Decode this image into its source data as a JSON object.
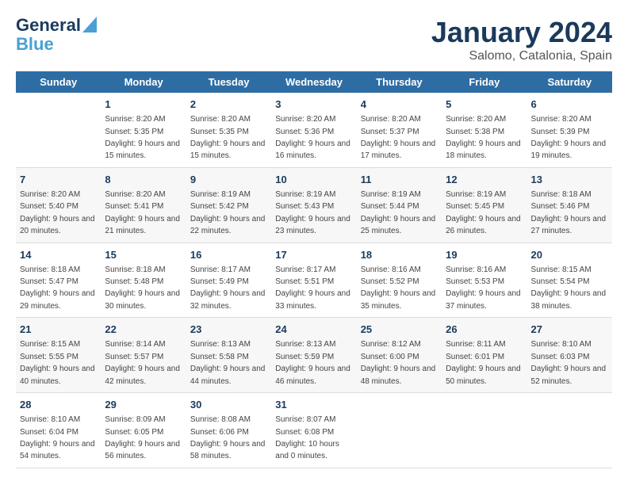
{
  "logo": {
    "line1": "General",
    "line2": "Blue"
  },
  "title": "January 2024",
  "location": "Salomo, Catalonia, Spain",
  "weekdays": [
    "Sunday",
    "Monday",
    "Tuesday",
    "Wednesday",
    "Thursday",
    "Friday",
    "Saturday"
  ],
  "weeks": [
    [
      {
        "day": null,
        "sunrise": null,
        "sunset": null,
        "daylight": null
      },
      {
        "day": "1",
        "sunrise": "8:20 AM",
        "sunset": "5:35 PM",
        "daylight": "9 hours and 15 minutes."
      },
      {
        "day": "2",
        "sunrise": "8:20 AM",
        "sunset": "5:35 PM",
        "daylight": "9 hours and 15 minutes."
      },
      {
        "day": "3",
        "sunrise": "8:20 AM",
        "sunset": "5:36 PM",
        "daylight": "9 hours and 16 minutes."
      },
      {
        "day": "4",
        "sunrise": "8:20 AM",
        "sunset": "5:37 PM",
        "daylight": "9 hours and 17 minutes."
      },
      {
        "day": "5",
        "sunrise": "8:20 AM",
        "sunset": "5:38 PM",
        "daylight": "9 hours and 18 minutes."
      },
      {
        "day": "6",
        "sunrise": "8:20 AM",
        "sunset": "5:39 PM",
        "daylight": "9 hours and 19 minutes."
      }
    ],
    [
      {
        "day": "7",
        "sunrise": "8:20 AM",
        "sunset": "5:40 PM",
        "daylight": "9 hours and 20 minutes."
      },
      {
        "day": "8",
        "sunrise": "8:20 AM",
        "sunset": "5:41 PM",
        "daylight": "9 hours and 21 minutes."
      },
      {
        "day": "9",
        "sunrise": "8:19 AM",
        "sunset": "5:42 PM",
        "daylight": "9 hours and 22 minutes."
      },
      {
        "day": "10",
        "sunrise": "8:19 AM",
        "sunset": "5:43 PM",
        "daylight": "9 hours and 23 minutes."
      },
      {
        "day": "11",
        "sunrise": "8:19 AM",
        "sunset": "5:44 PM",
        "daylight": "9 hours and 25 minutes."
      },
      {
        "day": "12",
        "sunrise": "8:19 AM",
        "sunset": "5:45 PM",
        "daylight": "9 hours and 26 minutes."
      },
      {
        "day": "13",
        "sunrise": "8:18 AM",
        "sunset": "5:46 PM",
        "daylight": "9 hours and 27 minutes."
      }
    ],
    [
      {
        "day": "14",
        "sunrise": "8:18 AM",
        "sunset": "5:47 PM",
        "daylight": "9 hours and 29 minutes."
      },
      {
        "day": "15",
        "sunrise": "8:18 AM",
        "sunset": "5:48 PM",
        "daylight": "9 hours and 30 minutes."
      },
      {
        "day": "16",
        "sunrise": "8:17 AM",
        "sunset": "5:49 PM",
        "daylight": "9 hours and 32 minutes."
      },
      {
        "day": "17",
        "sunrise": "8:17 AM",
        "sunset": "5:51 PM",
        "daylight": "9 hours and 33 minutes."
      },
      {
        "day": "18",
        "sunrise": "8:16 AM",
        "sunset": "5:52 PM",
        "daylight": "9 hours and 35 minutes."
      },
      {
        "day": "19",
        "sunrise": "8:16 AM",
        "sunset": "5:53 PM",
        "daylight": "9 hours and 37 minutes."
      },
      {
        "day": "20",
        "sunrise": "8:15 AM",
        "sunset": "5:54 PM",
        "daylight": "9 hours and 38 minutes."
      }
    ],
    [
      {
        "day": "21",
        "sunrise": "8:15 AM",
        "sunset": "5:55 PM",
        "daylight": "9 hours and 40 minutes."
      },
      {
        "day": "22",
        "sunrise": "8:14 AM",
        "sunset": "5:57 PM",
        "daylight": "9 hours and 42 minutes."
      },
      {
        "day": "23",
        "sunrise": "8:13 AM",
        "sunset": "5:58 PM",
        "daylight": "9 hours and 44 minutes."
      },
      {
        "day": "24",
        "sunrise": "8:13 AM",
        "sunset": "5:59 PM",
        "daylight": "9 hours and 46 minutes."
      },
      {
        "day": "25",
        "sunrise": "8:12 AM",
        "sunset": "6:00 PM",
        "daylight": "9 hours and 48 minutes."
      },
      {
        "day": "26",
        "sunrise": "8:11 AM",
        "sunset": "6:01 PM",
        "daylight": "9 hours and 50 minutes."
      },
      {
        "day": "27",
        "sunrise": "8:10 AM",
        "sunset": "6:03 PM",
        "daylight": "9 hours and 52 minutes."
      }
    ],
    [
      {
        "day": "28",
        "sunrise": "8:10 AM",
        "sunset": "6:04 PM",
        "daylight": "9 hours and 54 minutes."
      },
      {
        "day": "29",
        "sunrise": "8:09 AM",
        "sunset": "6:05 PM",
        "daylight": "9 hours and 56 minutes."
      },
      {
        "day": "30",
        "sunrise": "8:08 AM",
        "sunset": "6:06 PM",
        "daylight": "9 hours and 58 minutes."
      },
      {
        "day": "31",
        "sunrise": "8:07 AM",
        "sunset": "6:08 PM",
        "daylight": "10 hours and 0 minutes."
      },
      {
        "day": null,
        "sunrise": null,
        "sunset": null,
        "daylight": null
      },
      {
        "day": null,
        "sunrise": null,
        "sunset": null,
        "daylight": null
      },
      {
        "day": null,
        "sunrise": null,
        "sunset": null,
        "daylight": null
      }
    ]
  ]
}
